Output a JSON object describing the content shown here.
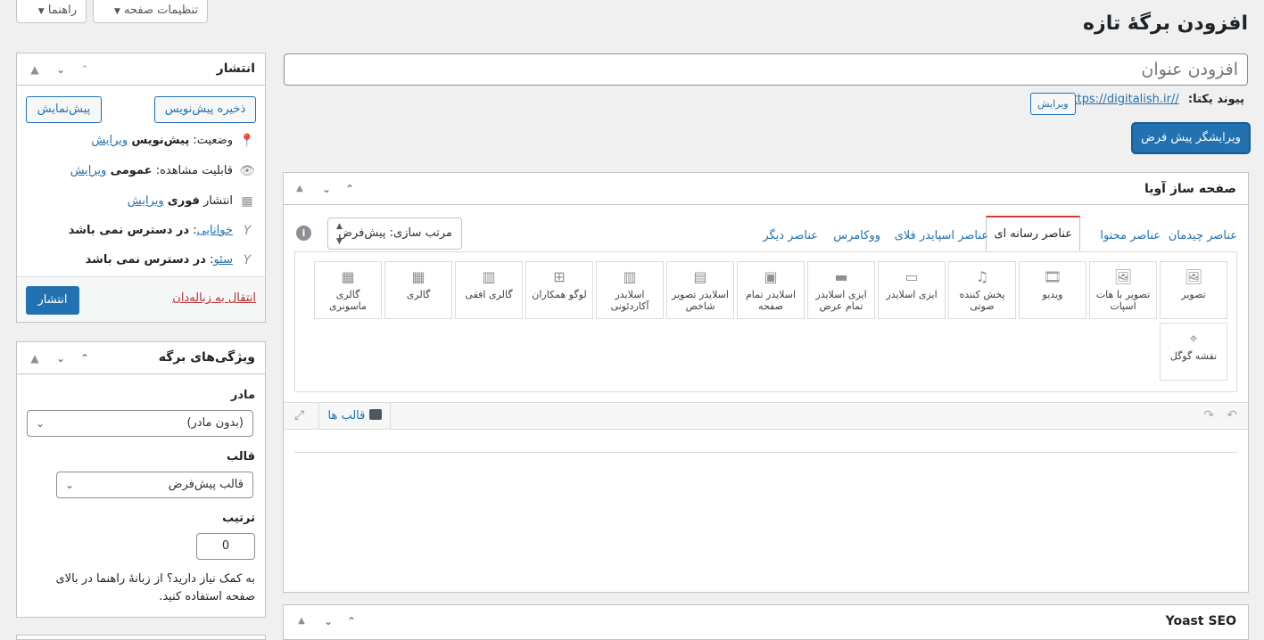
{
  "screen_tabs": {
    "help": "راهنما",
    "screen_options": "تنظیمات صفحه"
  },
  "page_title": "افزودن برگهٔ تازه",
  "title_input": {
    "placeholder": "افزودن عنوان"
  },
  "permalink": {
    "label": "پیوند یکتا:",
    "url": "https://digitalish.ir//",
    "edit_label": "ویرایش"
  },
  "default_editor_button": "ویرایشگر پیش فرض",
  "publish_box": {
    "title": "انتشار",
    "save_draft": "ذخیره پیش‌نویس",
    "preview": "پیش‌نمایش",
    "status_label": "وضعیت:",
    "status_value": "پیش‌نویس",
    "visibility_label": "قابلیت مشاهده:",
    "visibility_value": "عمومی",
    "publish_label": "انتشار",
    "publish_value": "فوری",
    "edit_link": "ویرایش",
    "readability_label": "خوانایی",
    "readability_value": "در دسترس نمی باشد",
    "seo_label": "سئو",
    "seo_value": "در دسترس نمی باشد",
    "trash_link": "انتقال به زباله‌دان",
    "publish_button": "انتشار"
  },
  "page_attributes": {
    "title": "ویژگی‌های برگه",
    "parent_label": "مادر",
    "parent_value": "(بدون مادر)",
    "template_label": "قالب",
    "template_value": "قالب پیش‌فرض",
    "order_label": "ترتیب",
    "order_value": "0",
    "help_text": "به کمک نیاز دارید؟ از زبانهٔ راهنما در بالای صفحه استفاده کنید."
  },
  "page_builder": {
    "title": "صفحه ساز آویا",
    "tabs": [
      "عناصر چیدمان",
      "عناصر محتوا",
      "عناصر رسانه ای",
      "عناصر اسپایدر فلای",
      "ووکامرس",
      "عناصر دیگر"
    ],
    "sort_label": "مرتب سازی: پیش‌فرض",
    "elements": [
      {
        "label": "تصویر",
        "icon": "image-icon",
        "glyph": "🖼"
      },
      {
        "label": "تصویر با هات اسپات",
        "icon": "hotspot-image-icon",
        "glyph": "🖼"
      },
      {
        "label": "ویدیو",
        "icon": "video-icon",
        "glyph": "🎞"
      },
      {
        "label": "پخش کننده صوتی",
        "icon": "audio-player-icon",
        "glyph": "♫"
      },
      {
        "label": "ایزی اسلایدر",
        "icon": "easy-slider-icon",
        "glyph": "▭"
      },
      {
        "label": "ایزی اسلایدر تمام عرض",
        "icon": "fullwidth-easy-slider-icon",
        "glyph": "▬"
      },
      {
        "label": "اسلایدر تمام صفحه",
        "icon": "fullscreen-slider-icon",
        "glyph": "▣"
      },
      {
        "label": "اسلایدر تصویر شاخص",
        "icon": "featured-image-slider-icon",
        "glyph": "▤"
      },
      {
        "label": "اسلایدر آکاردئونی",
        "icon": "accordion-slider-icon",
        "glyph": "▥"
      },
      {
        "label": "لوگو همکاران",
        "icon": "partner-logo-icon",
        "glyph": "⊞"
      },
      {
        "label": "گالری افقی",
        "icon": "horizontal-gallery-icon",
        "glyph": "▥"
      },
      {
        "label": "گالری",
        "icon": "gallery-icon",
        "glyph": "▦"
      },
      {
        "label": "گالری ماسونری",
        "icon": "masonry-gallery-icon",
        "glyph": "▦"
      },
      {
        "label": "نقشه گوگل",
        "icon": "google-map-icon",
        "glyph": "⌖"
      }
    ],
    "templates_label": "قالب ها"
  },
  "yoast_box": {
    "title": "Yoast SEO"
  },
  "colors": {
    "accent": "#2271b1",
    "danger": "#b32d2e",
    "bg": "#f0f0f1"
  }
}
